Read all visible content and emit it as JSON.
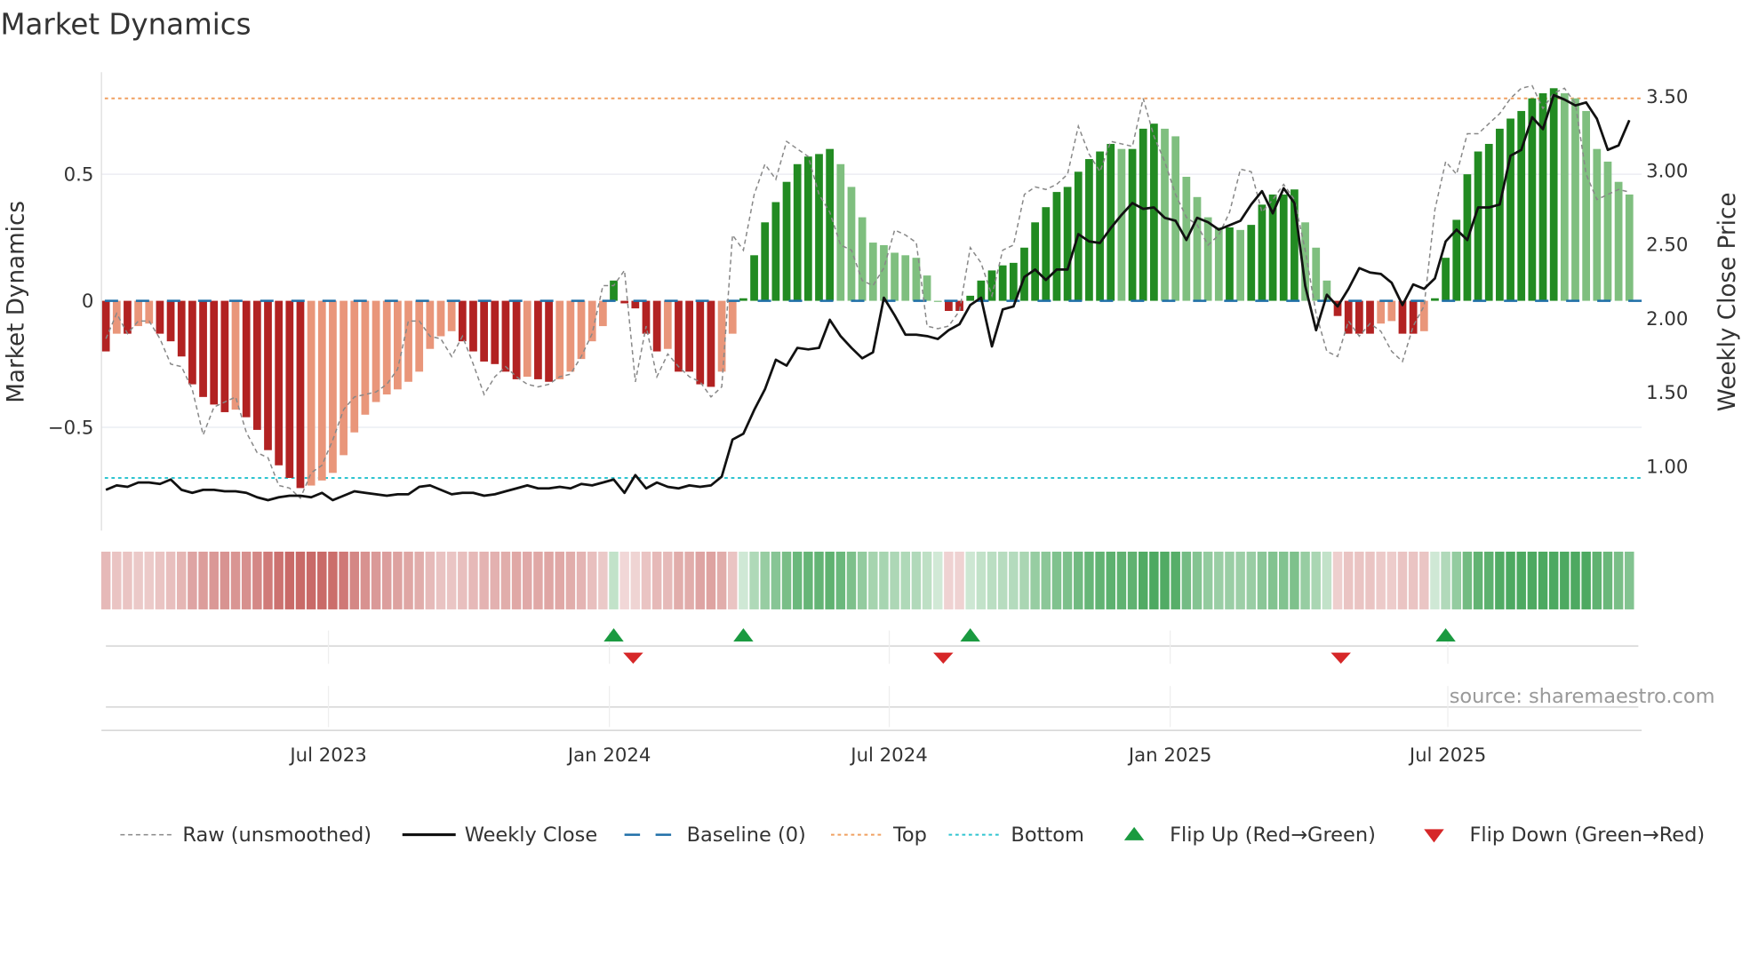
{
  "chart_data": {
    "type": "bar",
    "title": "Market Dynamics",
    "ylabel": "Market Dynamics",
    "y2label": "Weekly Close Price",
    "ylim": [
      -0.82,
      0.92
    ],
    "y2lim": [
      0.6,
      3.85
    ],
    "yticks": [
      {
        "value": 0.5,
        "label": "0.5"
      },
      {
        "value": 0,
        "label": "0"
      },
      {
        "value": -0.5,
        "label": "−0.5"
      }
    ],
    "y2ticks": [
      {
        "value": 3.5,
        "label": "3.50"
      },
      {
        "value": 3.0,
        "label": "3.00"
      },
      {
        "value": 2.5,
        "label": "2.50"
      },
      {
        "value": 2.0,
        "label": "2.00"
      },
      {
        "value": 1.5,
        "label": "1.50"
      },
      {
        "value": 1.0,
        "label": "1.00"
      }
    ],
    "xticks": [
      {
        "week": 20.6,
        "label": "Jul 2023"
      },
      {
        "week": 46.6,
        "label": "Jan 2024"
      },
      {
        "week": 72.5,
        "label": "Jul 2024"
      },
      {
        "week": 98.5,
        "label": "Jan 2025"
      },
      {
        "week": 124.2,
        "label": "Jul 2025"
      }
    ],
    "top_level": 0.8,
    "bottom_level": -0.7,
    "baseline": 0,
    "momentum": [
      -0.2,
      -0.13,
      -0.13,
      -0.1,
      -0.09,
      -0.13,
      -0.16,
      -0.22,
      -0.33,
      -0.38,
      -0.41,
      -0.44,
      -0.43,
      -0.46,
      -0.51,
      -0.59,
      -0.65,
      -0.7,
      -0.74,
      -0.73,
      -0.71,
      -0.68,
      -0.61,
      -0.52,
      -0.45,
      -0.4,
      -0.37,
      -0.35,
      -0.32,
      -0.28,
      -0.19,
      -0.14,
      -0.12,
      -0.16,
      -0.2,
      -0.24,
      -0.25,
      -0.28,
      -0.31,
      -0.3,
      -0.31,
      -0.32,
      -0.31,
      -0.28,
      -0.23,
      -0.16,
      -0.1,
      0.08,
      -0.01,
      -0.03,
      -0.13,
      -0.2,
      -0.19,
      -0.28,
      -0.28,
      -0.33,
      -0.34,
      -0.28,
      -0.13,
      0.01,
      0.18,
      0.31,
      0.39,
      0.47,
      0.54,
      0.57,
      0.58,
      0.6,
      0.54,
      0.45,
      0.33,
      0.23,
      0.22,
      0.19,
      0.18,
      0.17,
      0.1,
      0.0,
      -0.04,
      -0.04,
      0.02,
      0.08,
      0.12,
      0.14,
      0.15,
      0.21,
      0.31,
      0.37,
      0.43,
      0.45,
      0.51,
      0.56,
      0.59,
      0.62,
      0.6,
      0.6,
      0.68,
      0.7,
      0.68,
      0.65,
      0.49,
      0.41,
      0.33,
      0.29,
      0.29,
      0.28,
      0.3,
      0.38,
      0.42,
      0.42,
      0.44,
      0.31,
      0.21,
      0.08,
      -0.06,
      -0.13,
      -0.13,
      -0.13,
      -0.09,
      -0.08,
      -0.13,
      -0.13,
      -0.12,
      0.01,
      0.17,
      0.32,
      0.5,
      0.59,
      0.62,
      0.68,
      0.72,
      0.75,
      0.8,
      0.82,
      0.84,
      0.82,
      0.8,
      0.75,
      0.6,
      0.55,
      0.47,
      0.42
    ],
    "raw": [
      -0.15,
      -0.05,
      -0.13,
      -0.08,
      -0.08,
      -0.15,
      -0.25,
      -0.26,
      -0.35,
      -0.53,
      -0.42,
      -0.4,
      -0.38,
      -0.52,
      -0.6,
      -0.62,
      -0.73,
      -0.74,
      -0.78,
      -0.68,
      -0.65,
      -0.55,
      -0.43,
      -0.38,
      -0.37,
      -0.36,
      -0.33,
      -0.27,
      -0.08,
      -0.08,
      -0.14,
      -0.15,
      -0.22,
      -0.14,
      -0.25,
      -0.37,
      -0.3,
      -0.26,
      -0.3,
      -0.33,
      -0.34,
      -0.33,
      -0.3,
      -0.29,
      -0.22,
      -0.13,
      0.06,
      0.06,
      0.12,
      -0.32,
      -0.1,
      -0.3,
      -0.21,
      -0.26,
      -0.3,
      -0.32,
      -0.38,
      -0.34,
      0.26,
      0.2,
      0.42,
      0.54,
      0.48,
      0.63,
      0.6,
      0.57,
      0.42,
      0.35,
      0.22,
      0.2,
      0.08,
      0.06,
      0.13,
      0.28,
      0.26,
      0.23,
      -0.1,
      -0.11,
      -0.1,
      -0.04,
      0.21,
      0.15,
      0.02,
      0.2,
      0.22,
      0.42,
      0.45,
      0.44,
      0.46,
      0.5,
      0.69,
      0.58,
      0.51,
      0.63,
      0.62,
      0.61,
      0.8,
      0.65,
      0.55,
      0.42,
      0.33,
      0.3,
      0.22,
      0.26,
      0.35,
      0.52,
      0.51,
      0.35,
      0.4,
      0.46,
      0.4,
      0.2,
      -0.05,
      -0.2,
      -0.22,
      -0.08,
      -0.14,
      -0.09,
      -0.12,
      -0.2,
      -0.24,
      -0.1,
      -0.02,
      0.36,
      0.55,
      0.5,
      0.66,
      0.66,
      0.7,
      0.74,
      0.8,
      0.84,
      0.85,
      0.76,
      0.82,
      0.84,
      0.78,
      0.5,
      0.4,
      0.42,
      0.44,
      0.43
    ],
    "weekly_close": [
      0.84,
      0.87,
      0.86,
      0.89,
      0.89,
      0.88,
      0.91,
      0.84,
      0.82,
      0.84,
      0.84,
      0.83,
      0.83,
      0.82,
      0.79,
      0.77,
      0.79,
      0.8,
      0.8,
      0.79,
      0.82,
      0.77,
      0.8,
      0.83,
      0.82,
      0.81,
      0.8,
      0.81,
      0.81,
      0.86,
      0.87,
      0.84,
      0.81,
      0.82,
      0.82,
      0.8,
      0.81,
      0.83,
      0.85,
      0.87,
      0.85,
      0.85,
      0.86,
      0.85,
      0.88,
      0.87,
      0.89,
      0.91,
      0.82,
      0.94,
      0.85,
      0.89,
      0.86,
      0.85,
      0.87,
      0.86,
      0.87,
      0.93,
      1.18,
      1.22,
      1.38,
      1.52,
      1.72,
      1.68,
      1.8,
      1.79,
      1.8,
      1.99,
      1.88,
      1.8,
      1.73,
      1.77,
      2.14,
      2.02,
      1.89,
      1.89,
      1.88,
      1.86,
      1.92,
      1.96,
      2.09,
      2.14,
      1.81,
      2.06,
      2.08,
      2.28,
      2.33,
      2.26,
      2.33,
      2.33,
      2.57,
      2.52,
      2.51,
      2.61,
      2.7,
      2.78,
      2.74,
      2.75,
      2.68,
      2.66,
      2.53,
      2.68,
      2.65,
      2.6,
      2.63,
      2.66,
      2.77,
      2.86,
      2.71,
      2.88,
      2.78,
      2.22,
      1.92,
      2.16,
      2.08,
      2.2,
      2.34,
      2.31,
      2.3,
      2.24,
      2.09,
      2.23,
      2.2,
      2.27,
      2.52,
      2.6,
      2.53,
      2.75,
      2.75,
      2.77,
      3.1,
      3.14,
      3.36,
      3.28,
      3.51,
      3.48,
      3.44,
      3.46,
      3.35,
      3.14,
      3.17,
      3.34
    ],
    "flip_up_weeks": [
      47,
      59,
      80,
      124
    ],
    "flip_down_weeks": [
      48.8,
      77.5,
      114.3
    ],
    "legend": [
      {
        "label": "Raw (unsmoothed)",
        "kind": "raw"
      },
      {
        "label": "Weekly Close",
        "kind": "close"
      },
      {
        "label": "Baseline (0)",
        "kind": "baseline"
      },
      {
        "label": "Top",
        "kind": "top"
      },
      {
        "label": "Bottom",
        "kind": "bottom"
      },
      {
        "label": "Flip Up (Red→Green)",
        "kind": "up"
      },
      {
        "label": "Flip Down (Green→Red)",
        "kind": "down"
      }
    ],
    "legend_position": "bottom",
    "source": "source: sharemaestro.com",
    "colors": {
      "green_dark": "#228b22",
      "green_light": "#7fbf7f",
      "red_dark": "#b22222",
      "red_light": "#e9967a",
      "top": "#f0a060",
      "bottom": "#2ec4d0",
      "baseline": "#1f6fa8",
      "close": "#111111",
      "raw": "#888888",
      "flip_up": "#1a9a40",
      "flip_down": "#d62728"
    }
  }
}
